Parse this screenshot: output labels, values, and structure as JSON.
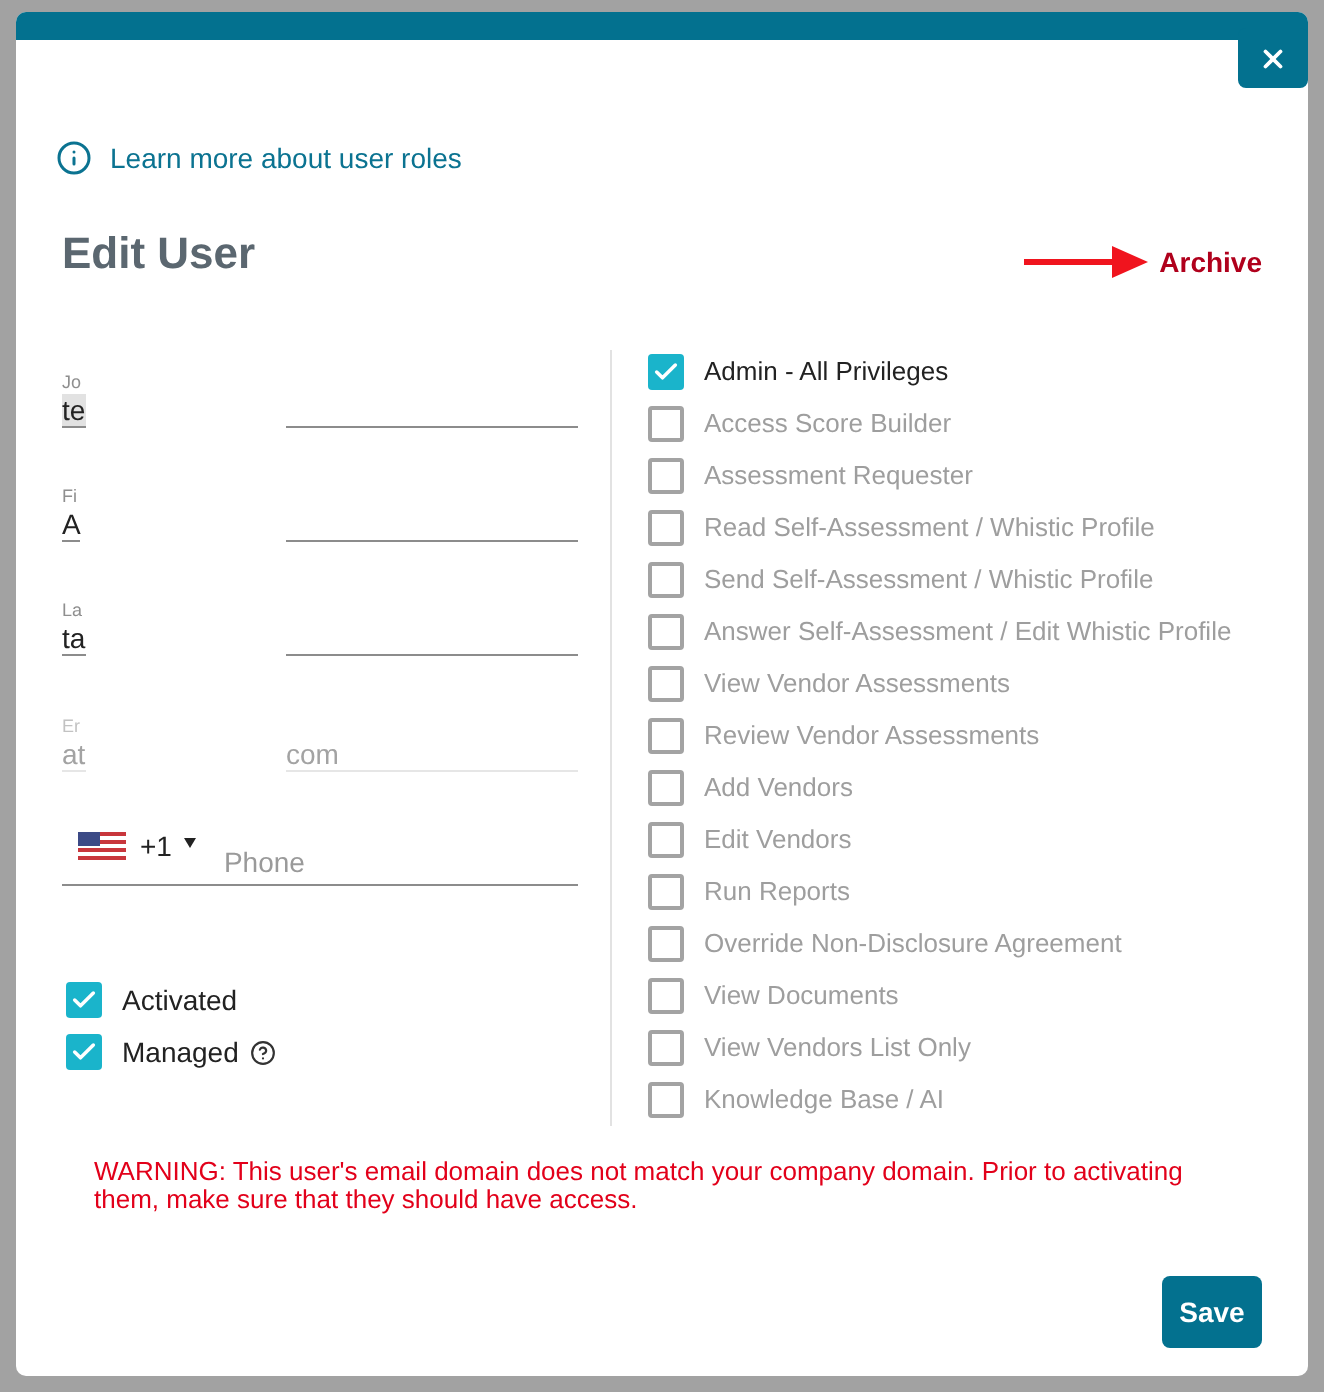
{
  "link": {
    "text": "Learn more about user roles"
  },
  "title": "Edit User",
  "archive": {
    "label": "Archive"
  },
  "fields": [
    {
      "label": "Jo",
      "value": "te",
      "highlighted": true,
      "disabled": false
    },
    {
      "label": "Fi",
      "value": "A",
      "highlighted": false,
      "disabled": false
    },
    {
      "label": "La",
      "value": "ta",
      "highlighted": false,
      "disabled": false
    },
    {
      "label": "Er",
      "value": "at",
      "value_end": "com",
      "highlighted": false,
      "disabled": true
    }
  ],
  "phone": {
    "country_code": "+1",
    "placeholder": "Phone"
  },
  "toggles": [
    {
      "label": "Activated",
      "checked": true,
      "help": false
    },
    {
      "label": "Managed",
      "checked": true,
      "help": true
    }
  ],
  "permissions": [
    {
      "label": "Admin - All Privileges",
      "checked": true,
      "disabled": false
    },
    {
      "label": "Access Score Builder",
      "checked": false,
      "disabled": true
    },
    {
      "label": "Assessment Requester",
      "checked": false,
      "disabled": true
    },
    {
      "label": "Read Self-Assessment / Whistic Profile",
      "checked": false,
      "disabled": true
    },
    {
      "label": "Send Self-Assessment / Whistic Profile",
      "checked": false,
      "disabled": true
    },
    {
      "label": "Answer Self-Assessment / Edit Whistic Profile",
      "checked": false,
      "disabled": true
    },
    {
      "label": "View Vendor Assessments",
      "checked": false,
      "disabled": true
    },
    {
      "label": "Review Vendor Assessments",
      "checked": false,
      "disabled": true
    },
    {
      "label": "Add Vendors",
      "checked": false,
      "disabled": true
    },
    {
      "label": "Edit Vendors",
      "checked": false,
      "disabled": true
    },
    {
      "label": "Run Reports",
      "checked": false,
      "disabled": true
    },
    {
      "label": "Override Non-Disclosure Agreement",
      "checked": false,
      "disabled": true
    },
    {
      "label": "View Documents",
      "checked": false,
      "disabled": true
    },
    {
      "label": "View Vendors List Only",
      "checked": false,
      "disabled": true
    },
    {
      "label": "Knowledge Base / AI",
      "checked": false,
      "disabled": true
    }
  ],
  "warning": "WARNING: This user's email domain does not match your company domain. Prior to activating them, make sure that they should have access.",
  "buttons": {
    "save": "Save"
  }
}
